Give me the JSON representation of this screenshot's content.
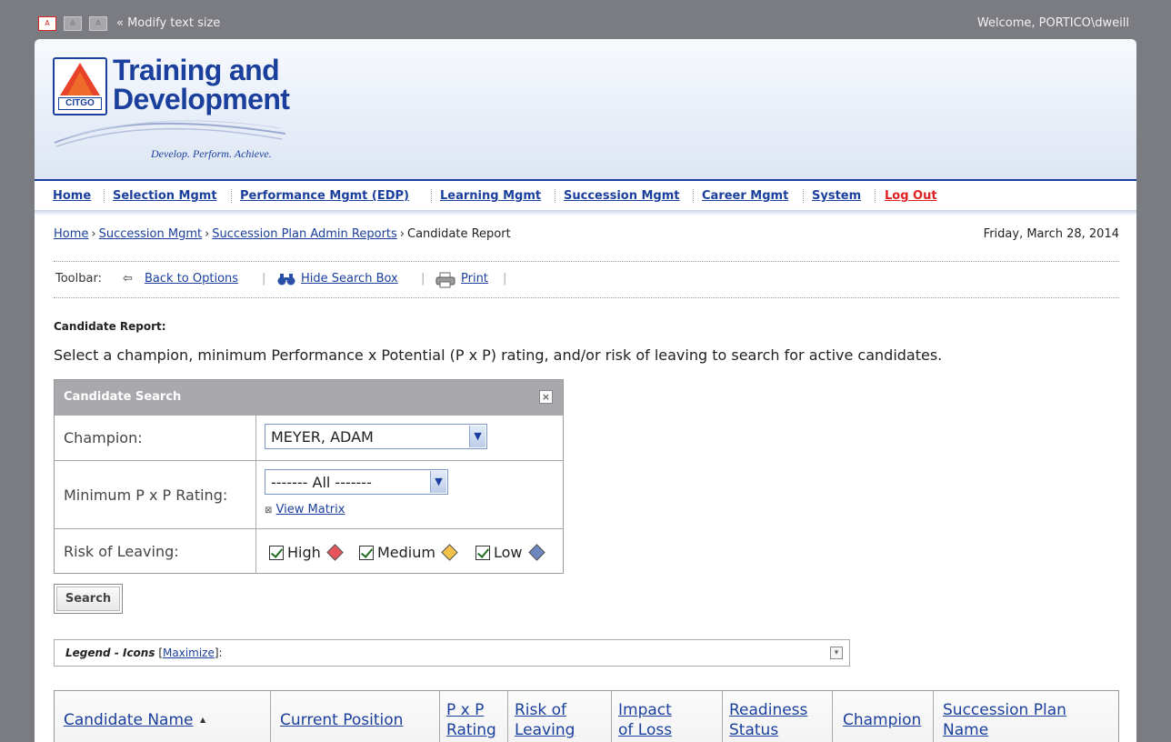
{
  "topbar": {
    "size_buttons": [
      "A",
      "A",
      "A"
    ],
    "modify_label": "« Modify text size",
    "welcome": "Welcome, PORTICO\\dweill"
  },
  "brand": {
    "logo_text": "CITGO",
    "title_line1": "Training and",
    "title_line2": "Development",
    "tagline": "Develop. Perform. Achieve."
  },
  "nav": [
    "Home",
    "Selection Mgmt",
    "Performance Mgmt (EDP)",
    "Learning Mgmt",
    "Succession Mgmt",
    "Career Mgmt",
    "System",
    "Log Out"
  ],
  "breadcrumb": [
    "Home",
    "Succession Mgmt",
    "Succession Plan Admin Reports",
    "Candidate Report"
  ],
  "date": "Friday, March 28, 2014",
  "toolbar": {
    "label": "Toolbar:",
    "back": "Back to Options",
    "hide": "Hide Search Box",
    "print": "Print"
  },
  "report": {
    "title": "Candidate Report:",
    "instructions": "Select a champion, minimum Performance x Potential (P x P) rating, and/or risk of leaving to search for active candidates."
  },
  "search_box": {
    "title": "Candidate Search",
    "champion_label": "Champion:",
    "champion_value": "MEYER, ADAM",
    "pxp_label": "Minimum P x P Rating:",
    "pxp_value": "------- All -------",
    "view_matrix": "View Matrix",
    "risk_label": "Risk of Leaving:",
    "risk_options": [
      {
        "label": "High",
        "checked": true,
        "color": "#e8545c"
      },
      {
        "label": "Medium",
        "checked": true,
        "color": "#f2c24a"
      },
      {
        "label": "Low",
        "checked": true,
        "color": "#6d87c0"
      }
    ],
    "search_button": "Search"
  },
  "legend": {
    "label": "Legend - Icons",
    "link": "Maximize",
    "open_bracket": "[",
    "close_bracket": "]:"
  },
  "table_headers": {
    "candidate_name": "Candidate Name",
    "sort_indicator": "▲",
    "current_position": "Current Position",
    "pxp_1": "P x P",
    "pxp_2": "Rating",
    "risk_1": "Risk of",
    "risk_2": "Leaving",
    "impact_1": "Impact",
    "impact_2": "of Loss",
    "readiness_1": "Readiness",
    "readiness_2": "Status",
    "champion": "Champion",
    "plan_1": "Succession Plan",
    "plan_2": "Name"
  },
  "colors": {
    "brand_blue": "#1a3f9c",
    "logout_red": "#e02020",
    "page_gray": "#7b7b82",
    "header_gray": "#a8a8ad"
  }
}
